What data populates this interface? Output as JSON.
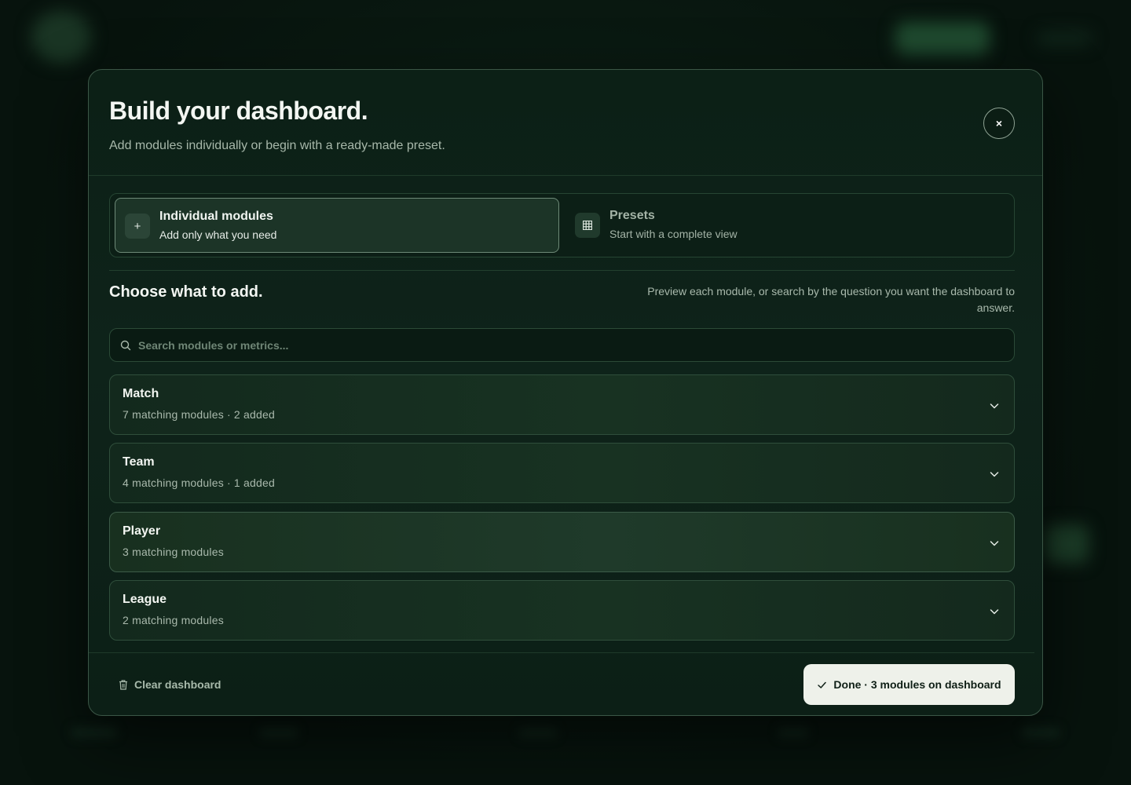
{
  "modal": {
    "title": "Build your dashboard.",
    "subtitle": "Add modules individually or begin with a ready-made preset.",
    "close_label": "×"
  },
  "modes": [
    {
      "label": "Individual modules",
      "description": "Add only what you need",
      "icon": "plus-icon",
      "active": true
    },
    {
      "label": "Presets",
      "description": "Start with a complete view",
      "icon": "grid-icon",
      "active": false
    }
  ],
  "section": {
    "title": "Choose what to add.",
    "help": "Preview each module, or search by the question you want the dashboard to answer."
  },
  "search": {
    "placeholder": "Search modules or metrics...",
    "value": ""
  },
  "categories": [
    {
      "name": "Match",
      "meta": "7 matching modules · 2 added"
    },
    {
      "name": "Team",
      "meta": "4 matching modules · 1 added"
    },
    {
      "name": "Player",
      "meta": "3 matching modules"
    },
    {
      "name": "League",
      "meta": "2 matching modules"
    }
  ],
  "footer": {
    "clear_label": "Clear dashboard",
    "done_label": "Done · 3 modules on dashboard"
  },
  "colors": {
    "accent": "#eef1ea",
    "background": "#07130d",
    "panel": "#0e231a",
    "border": "#3b5646"
  }
}
